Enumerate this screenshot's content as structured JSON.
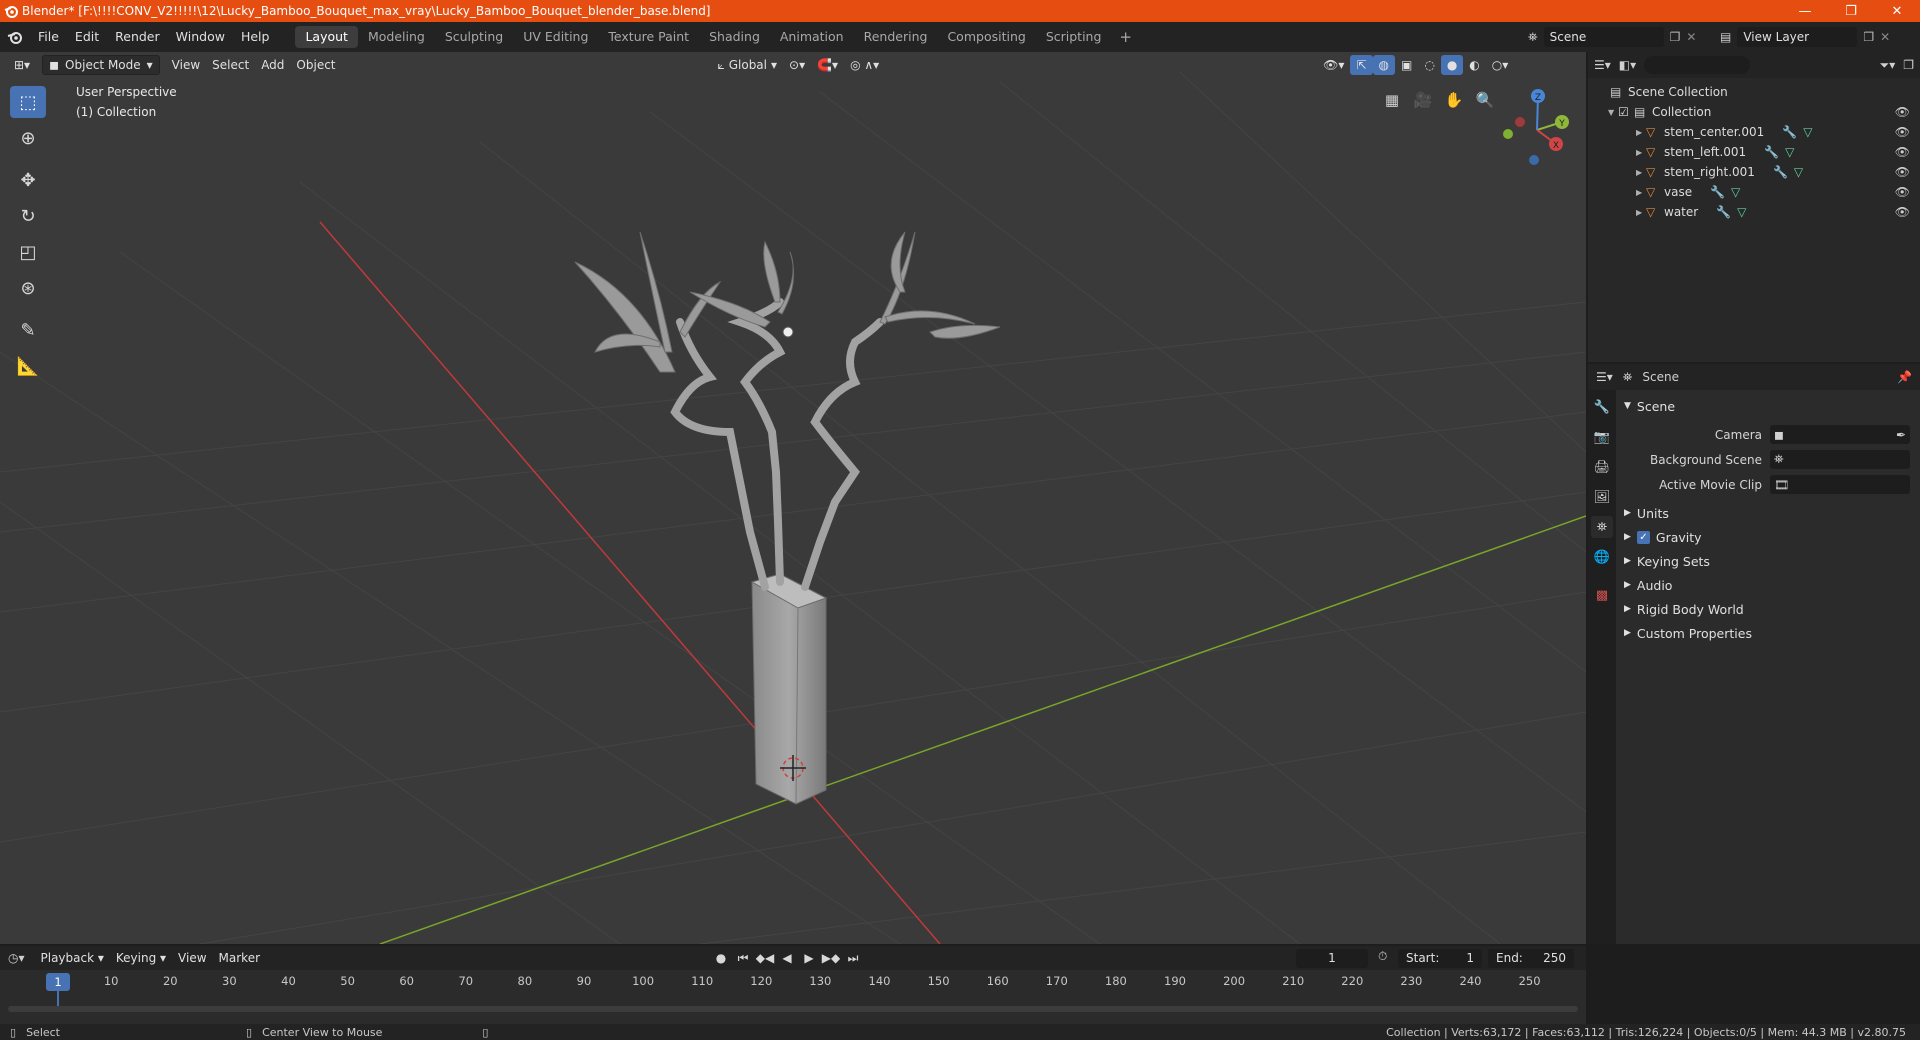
{
  "window": {
    "title": "Blender* [F:\\!!!!CONV_V2!!!!!\\12\\Lucky_Bamboo_Bouquet_max_vray\\Lucky_Bamboo_Bouquet_blender_base.blend]",
    "controls": {
      "minimize": "—",
      "restore": "❐",
      "close": "✕"
    }
  },
  "menu": {
    "items": [
      "File",
      "Edit",
      "Render",
      "Window",
      "Help"
    ],
    "workspaces": [
      "Layout",
      "Modeling",
      "Sculpting",
      "UV Editing",
      "Texture Paint",
      "Shading",
      "Animation",
      "Rendering",
      "Compositing",
      "Scripting"
    ],
    "active_workspace": "Layout",
    "add_workspace": "+",
    "scene": "Scene",
    "view_layer": "View Layer"
  },
  "viewport": {
    "mode": "Object Mode",
    "menus": [
      "View",
      "Select",
      "Add",
      "Object"
    ],
    "transform_orientation": "Global",
    "overlay_line1": "User Perspective",
    "overlay_line2": "(1) Collection",
    "gizmo_axes": {
      "x": "X",
      "y": "Y",
      "z": "Z"
    }
  },
  "tools": [
    "select-box",
    "cursor",
    "move",
    "rotate",
    "scale",
    "transform",
    "annotate",
    "measure"
  ],
  "outliner": {
    "root": "Scene Collection",
    "collection": "Collection",
    "objects": [
      {
        "name": "stem_center.001"
      },
      {
        "name": "stem_left.001"
      },
      {
        "name": "stem_right.001"
      },
      {
        "name": "vase"
      },
      {
        "name": "water"
      }
    ]
  },
  "properties": {
    "header": "Scene",
    "panel": "Scene",
    "fields": [
      {
        "label": "Camera",
        "value": ""
      },
      {
        "label": "Background Scene",
        "value": ""
      },
      {
        "label": "Active Movie Clip",
        "value": ""
      }
    ],
    "sections": [
      "Units",
      "Gravity",
      "Keying Sets",
      "Audio",
      "Rigid Body World",
      "Custom Properties"
    ],
    "gravity_checked": true
  },
  "timeline": {
    "menus": [
      "Playback",
      "Keying",
      "View",
      "Marker"
    ],
    "current_frame": "1",
    "start_label": "Start:",
    "start": "1",
    "end_label": "End:",
    "end": "250",
    "ruler": [
      "10",
      "20",
      "30",
      "40",
      "50",
      "60",
      "70",
      "80",
      "90",
      "100",
      "110",
      "120",
      "130",
      "140",
      "150",
      "160",
      "170",
      "180",
      "190",
      "200",
      "210",
      "220",
      "230",
      "240",
      "250"
    ],
    "ruler_current": "1"
  },
  "status": {
    "left1": "Select",
    "left2": "Center View to Mouse",
    "right": "Collection | Verts:63,172 | Faces:63,112 | Tris:126,224 | Objects:0/5 | Mem: 44.3 MB | v2.80.75"
  },
  "colors": {
    "titlebar": "#e54d11",
    "accent": "#4772b3",
    "x_axis": "#c0393b",
    "y_axis": "#7aa52a",
    "mesh": "#9a9a9a"
  }
}
